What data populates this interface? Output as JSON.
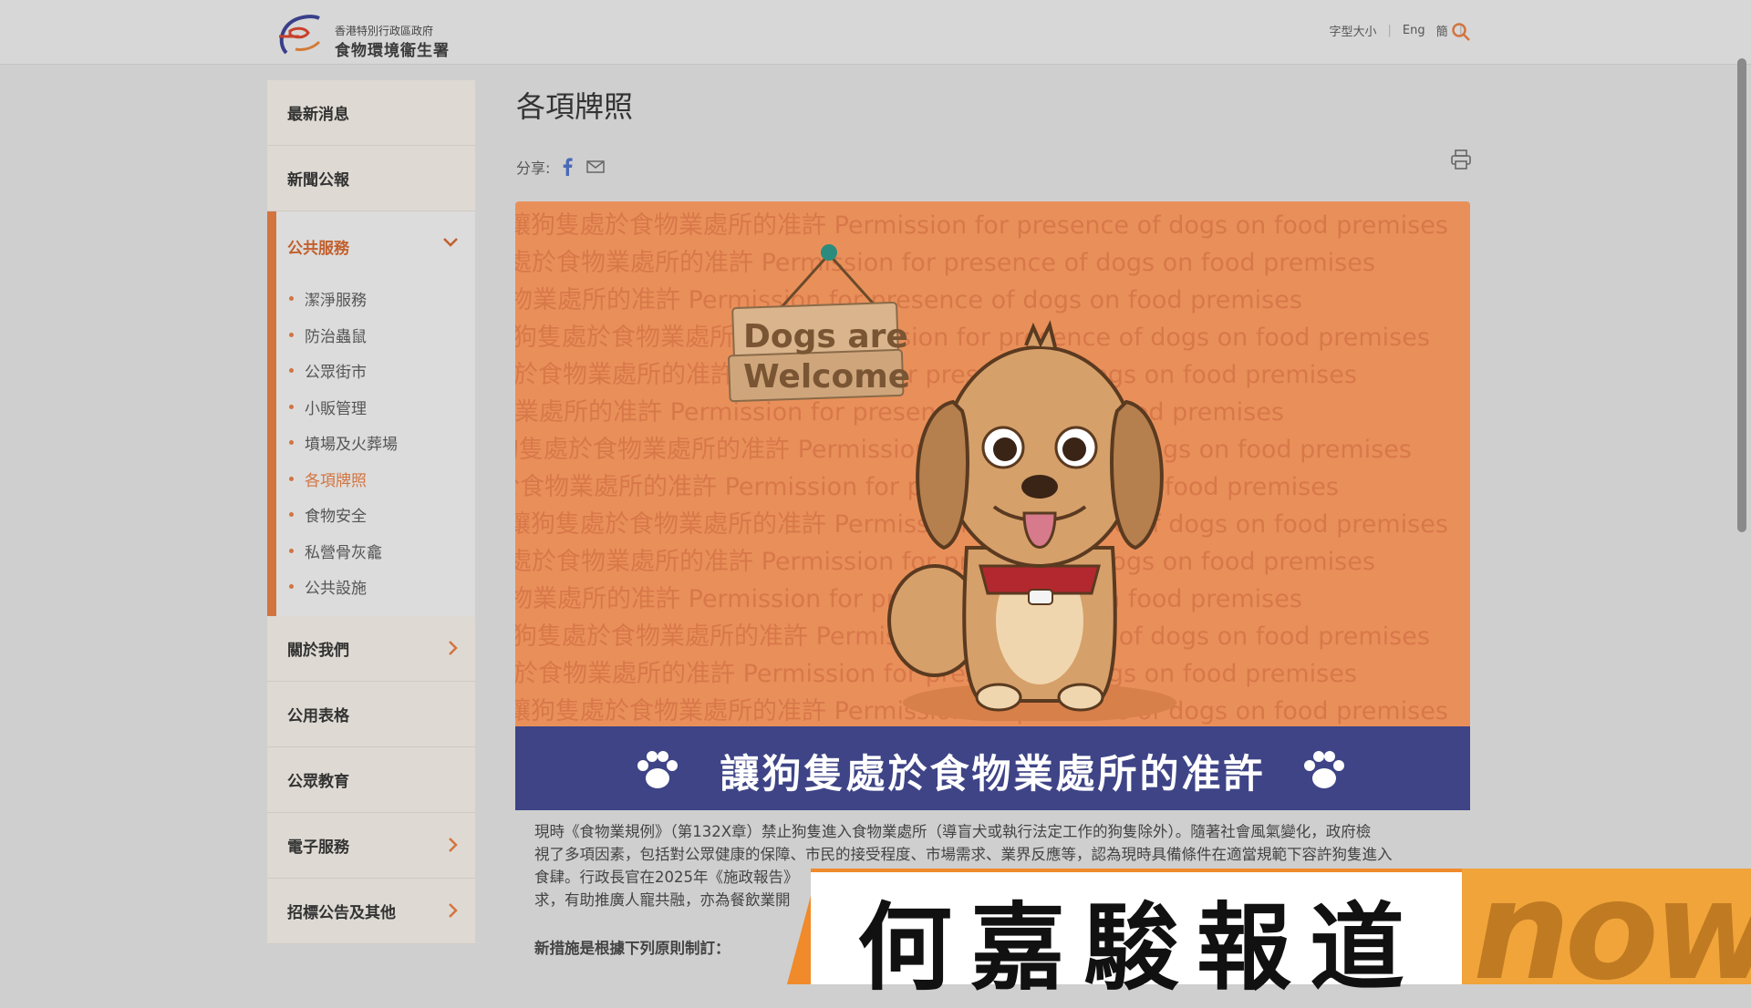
{
  "header": {
    "logo_line1": "香港特別行政區政府",
    "logo_line2": "食物環境衞生署",
    "topnav": {
      "font_size": "字型大小",
      "eng": "Eng",
      "simplified": "簡"
    }
  },
  "sidebar": {
    "items_top": [
      {
        "label": "最新消息"
      },
      {
        "label": "新聞公報"
      }
    ],
    "open_section": {
      "label": "公共服務",
      "sub_items": [
        {
          "label": "潔淨服務",
          "active": false
        },
        {
          "label": "防治蟲鼠",
          "active": false
        },
        {
          "label": "公眾街市",
          "active": false
        },
        {
          "label": "小販管理",
          "active": false
        },
        {
          "label": "墳場及火葬場",
          "active": false
        },
        {
          "label": "各項牌照",
          "active": true
        },
        {
          "label": "食物安全",
          "active": false
        },
        {
          "label": "私營骨灰龕",
          "active": false
        },
        {
          "label": "公共設施",
          "active": false
        }
      ]
    },
    "items_bottom": [
      {
        "label": "關於我們",
        "has_chevron": true
      },
      {
        "label": "公用表格",
        "has_chevron": false
      },
      {
        "label": "公眾教育",
        "has_chevron": false
      },
      {
        "label": "電子服務",
        "has_chevron": true
      },
      {
        "label": "招標公告及其他",
        "has_chevron": true
      }
    ]
  },
  "main": {
    "title": "各項牌照",
    "share_label": "分享:",
    "banner": {
      "sign_line1": "Dogs are",
      "sign_line2": "Welcome",
      "watermark": "讓狗隻處於食物業處所的准許 Permission for presence of dogs on food premises",
      "title": "讓狗隻處於食物業處所的准許"
    },
    "body_line1": "現時《食物業規例》（第132X章）禁止狗隻進入食物業處所（導盲犬或執行法定工作的狗隻除外）。隨著社會風氣變化，政府檢",
    "body_line2": "視了多項因素，包括對公眾健康的保障、市民的接受程度、市場需求、業界反應等，認為現時具備條件在適當規範下容許狗隻進入",
    "body_line3": "食肆。行政長官在2025年《施政報告》",
    "body_line4": "求，有助推廣人寵共融，亦為餐飲業開",
    "note": "新措施是根據下列原則制訂："
  },
  "overlay": {
    "reporter": "何嘉駿報道",
    "channel_logo": "now"
  },
  "colors": {
    "accent": "#d3743f",
    "banner_orange": "#e9905a",
    "banner_navy": "#3e4486"
  }
}
